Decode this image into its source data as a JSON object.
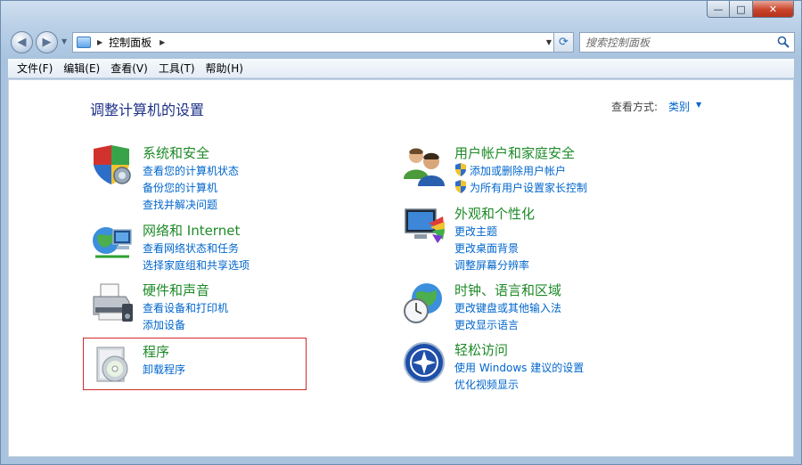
{
  "window": {
    "controls": {
      "minimize": "—",
      "maximize": "□",
      "close": "✕"
    }
  },
  "nav": {
    "address": {
      "icon": "control-panel-icon",
      "path": "控制面板"
    },
    "search": {
      "placeholder": "搜索控制面板",
      "icon": "search-icon"
    }
  },
  "menu": {
    "items": [
      "文件(F)",
      "编辑(E)",
      "查看(V)",
      "工具(T)",
      "帮助(H)"
    ]
  },
  "content": {
    "title": "调整计算机的设置",
    "view_by_label": "查看方式:",
    "view_by_value": "类别"
  },
  "categories": {
    "system": {
      "icon": "security-shield-icon",
      "title": "系统和安全",
      "links": [
        "查看您的计算机状态",
        "备份您的计算机",
        "查找并解决问题"
      ]
    },
    "network": {
      "icon": "network-globe-icon",
      "title": "网络和 Internet",
      "links": [
        "查看网络状态和任务",
        "选择家庭组和共享选项"
      ]
    },
    "hardware": {
      "icon": "printer-icon",
      "title": "硬件和声音",
      "links": [
        "查看设备和打印机",
        "添加设备"
      ]
    },
    "programs": {
      "icon": "programs-disc-icon",
      "title": "程序",
      "links": [
        "卸载程序"
      ]
    },
    "users": {
      "icon": "users-icon",
      "title": "用户帐户和家庭安全",
      "links": [
        "添加或删除用户帐户",
        "为所有用户设置家长控制"
      ]
    },
    "appearance": {
      "icon": "monitor-palette-icon",
      "title": "外观和个性化",
      "links": [
        "更改主题",
        "更改桌面背景",
        "调整屏幕分辨率"
      ]
    },
    "clock": {
      "icon": "clock-globe-icon",
      "title": "时钟、语言和区域",
      "links": [
        "更改键盘或其他输入法",
        "更改显示语言"
      ]
    },
    "ease": {
      "icon": "ease-of-access-icon",
      "title": "轻松访问",
      "links": [
        "使用 Windows 建议的设置",
        "优化视频显示"
      ]
    }
  },
  "colors": {
    "category_title": "#1e8a28",
    "link": "#0066cc",
    "page_title": "#1e3287",
    "highlight": "#d12b2b"
  }
}
